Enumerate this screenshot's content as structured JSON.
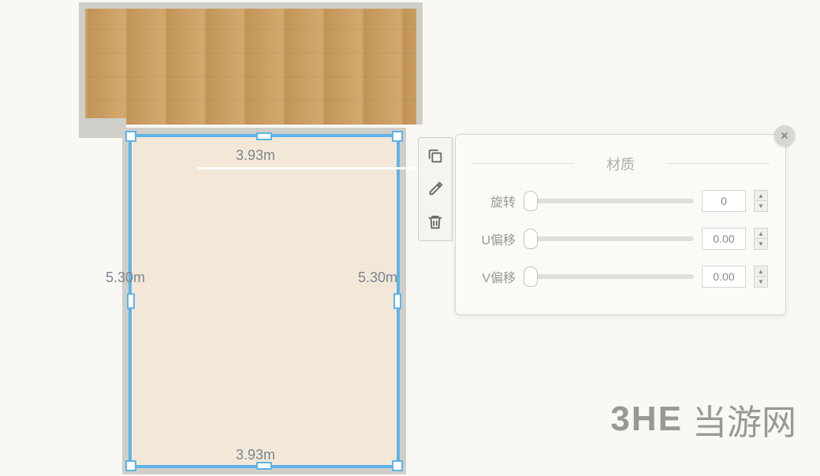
{
  "floorplan": {
    "dimensions": {
      "width_top": "3.93m",
      "width_bottom": "3.93m",
      "height_left": "5.30m",
      "height_right": "5.30m"
    }
  },
  "toolbar": {
    "copy_icon": "copy-icon",
    "eyedropper_icon": "eyedropper-icon",
    "delete_icon": "trash-icon"
  },
  "panel": {
    "title": "材质",
    "close_icon": "close-icon",
    "sliders": [
      {
        "label": "旋转",
        "value": "0"
      },
      {
        "label": "U偏移",
        "value": "0.00"
      },
      {
        "label": "V偏移",
        "value": "0.00"
      }
    ]
  },
  "watermark": {
    "logo": "3HE",
    "text": "当游网"
  }
}
